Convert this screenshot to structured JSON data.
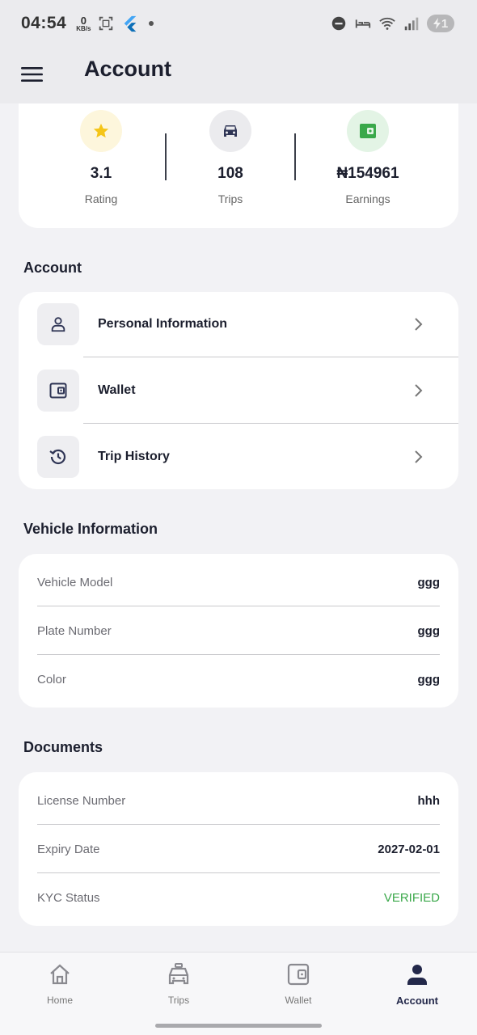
{
  "status_bar": {
    "time": "04:54",
    "net_speed_value": "0",
    "net_speed_unit": "KB/s",
    "battery": "1"
  },
  "app_bar": {
    "title": "Account"
  },
  "stats": [
    {
      "value": "3.1",
      "label": "Rating",
      "icon": "star-icon"
    },
    {
      "value": "108",
      "label": "Trips",
      "icon": "car-icon"
    },
    {
      "value": "₦154961",
      "label": "Earnings",
      "icon": "wallet-icon"
    }
  ],
  "account_section": {
    "title": "Account",
    "items": [
      {
        "label": "Personal Information",
        "icon": "person-icon"
      },
      {
        "label": "Wallet",
        "icon": "wallet-icon"
      },
      {
        "label": "Trip History",
        "icon": "history-icon"
      }
    ]
  },
  "vehicle_section": {
    "title": "Vehicle Information",
    "rows": [
      {
        "key": "Vehicle Model",
        "value": "ggg"
      },
      {
        "key": "Plate Number",
        "value": "ggg"
      },
      {
        "key": "Color",
        "value": "ggg"
      }
    ]
  },
  "documents_section": {
    "title": "Documents",
    "rows": [
      {
        "key": "License Number",
        "value": "hhh"
      },
      {
        "key": "Expiry Date",
        "value": "2027-02-01"
      },
      {
        "key": "KYC Status",
        "value": "VERIFIED"
      }
    ]
  },
  "bottom_nav": [
    {
      "label": "Home",
      "icon": "home-icon"
    },
    {
      "label": "Trips",
      "icon": "taxi-icon"
    },
    {
      "label": "Wallet",
      "icon": "wallet-icon"
    },
    {
      "label": "Account",
      "icon": "person-icon",
      "active": true
    }
  ],
  "colors": {
    "accent": "#23284a",
    "verified": "#3aa84a",
    "rating_bg": "#fdf6dc",
    "earnings_bg": "#e3f4e5"
  }
}
